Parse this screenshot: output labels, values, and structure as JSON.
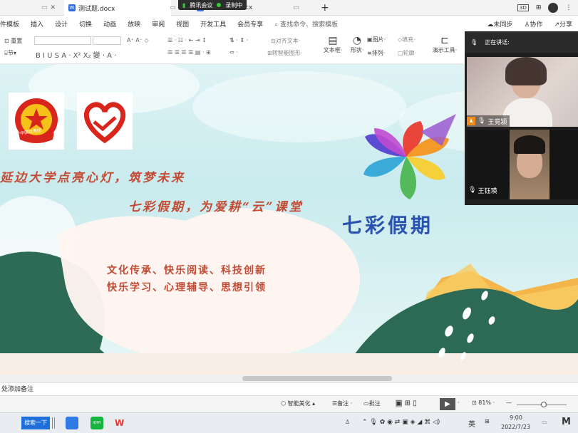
{
  "tabs": {
    "home_label": "",
    "doc1": "测试题.docx",
    "doc2_partial": ".docx"
  },
  "meeting_bar": {
    "app": "腾讯会议",
    "status": "录制中"
  },
  "top_right": {
    "sync": "未同步",
    "collab": "协作",
    "share": "分享"
  },
  "menu": [
    "件模板",
    "插入",
    "设计",
    "切换",
    "动画",
    "放映",
    "审阅",
    "视图",
    "开发工具",
    "会员专享"
  ],
  "search": {
    "placeholder": "查找命令、搜索模板"
  },
  "ribbon": {
    "reset": "重置",
    "section": "节",
    "align_text": "对齐文本",
    "convert": "转智能图形",
    "textbox": "文本框",
    "shape": "形状",
    "picture": "图片",
    "arrange": "排列",
    "fill": "填充",
    "outline": "轮廓",
    "presenter": "演示工具"
  },
  "slide": {
    "line1": "延边大学点亮心灯，筑梦未来",
    "line2": "七彩假期，为爱耕“云”课堂",
    "brand": "七彩假期",
    "topics1": "文化传承、快乐阅读、科技创新",
    "topics2": "快乐学习、心理辅导、思想引领",
    "badge_text": "中国共青团"
  },
  "video": {
    "header": "正在讲话:",
    "participant1": "王竞颍",
    "participant2": "王钰瑛"
  },
  "notes": {
    "placeholder": "处添加备注"
  },
  "status": {
    "beautify": "智能美化",
    "notes": "备注",
    "comment": "批注",
    "zoom": "81%"
  },
  "taskbar": {
    "search_btn": "搜索一下",
    "lang": "英",
    "time": "9:00",
    "date": "2022/7/23"
  }
}
